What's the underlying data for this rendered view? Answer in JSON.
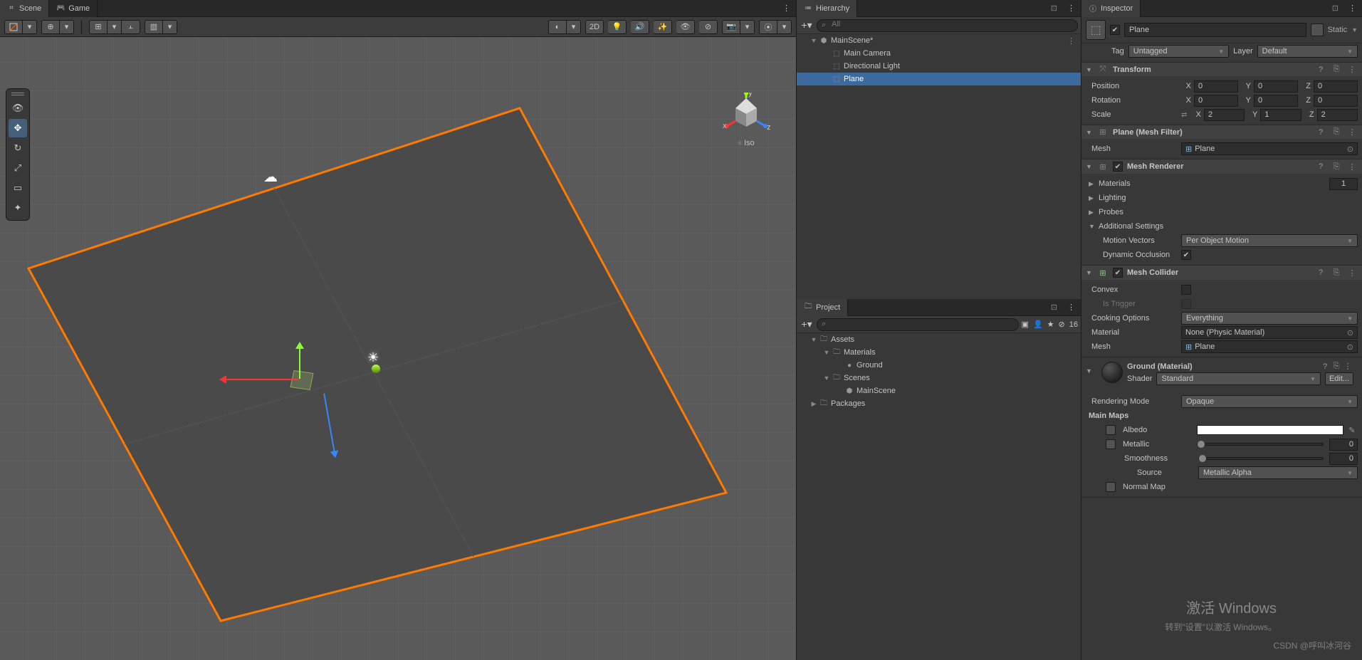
{
  "tabs": {
    "scene": "Scene",
    "game": "Game",
    "hierarchy": "Hierarchy",
    "project": "Project",
    "inspector": "Inspector"
  },
  "sceneToolbar": {
    "twoD": "2D"
  },
  "orient": {
    "x": "x",
    "y": "y",
    "z": "z",
    "mode": "Iso"
  },
  "hierarchy": {
    "searchPlaceholder": "All",
    "root": "MainScene*",
    "items": [
      "Main Camera",
      "Directional Light",
      "Plane"
    ]
  },
  "project": {
    "searchPlaceholder": "",
    "count": "16",
    "assets": "Assets",
    "materials": "Materials",
    "ground": "Ground",
    "scenes": "Scenes",
    "mainscene": "MainScene",
    "packages": "Packages"
  },
  "inspector": {
    "name": "Plane",
    "static": "Static",
    "tagLbl": "Tag",
    "tagVal": "Untagged",
    "layerLbl": "Layer",
    "layerVal": "Default",
    "transform": {
      "title": "Transform",
      "pos": "Position",
      "rot": "Rotation",
      "scale": "Scale",
      "px": "0",
      "py": "0",
      "pz": "0",
      "rx": "0",
      "ry": "0",
      "rz": "0",
      "sx": "2",
      "sy": "1",
      "sz": "2"
    },
    "meshFilter": {
      "title": "Plane (Mesh Filter)",
      "meshLbl": "Mesh",
      "meshVal": "Plane"
    },
    "meshRenderer": {
      "title": "Mesh Renderer",
      "materials": "Materials",
      "matCount": "1",
      "lighting": "Lighting",
      "probes": "Probes",
      "addl": "Additional Settings",
      "motionLbl": "Motion Vectors",
      "motionVal": "Per Object Motion",
      "dynOcc": "Dynamic Occlusion"
    },
    "meshCollider": {
      "title": "Mesh Collider",
      "convex": "Convex",
      "isTrigger": "Is Trigger",
      "cookLbl": "Cooking Options",
      "cookVal": "Everything",
      "matLbl": "Material",
      "matVal": "None (Physic Material)",
      "meshLbl": "Mesh",
      "meshVal": "Plane"
    },
    "material": {
      "title": "Ground (Material)",
      "shaderLbl": "Shader",
      "shaderVal": "Standard",
      "edit": "Edit...",
      "renderLbl": "Rendering Mode",
      "renderVal": "Opaque",
      "mainMaps": "Main Maps",
      "albedo": "Albedo",
      "metallic": "Metallic",
      "metallicVal": "0",
      "smooth": "Smoothness",
      "smoothVal": "0",
      "sourceLbl": "Source",
      "sourceVal": "Metallic Alpha",
      "normal": "Normal Map"
    }
  },
  "axes": {
    "x": "X",
    "y": "Y",
    "z": "Z"
  },
  "watermark": {
    "l1": "激活 Windows",
    "l2": "转到\"设置\"以激活 Windows。",
    "l3": "CSDN @呼叫冰河谷"
  }
}
